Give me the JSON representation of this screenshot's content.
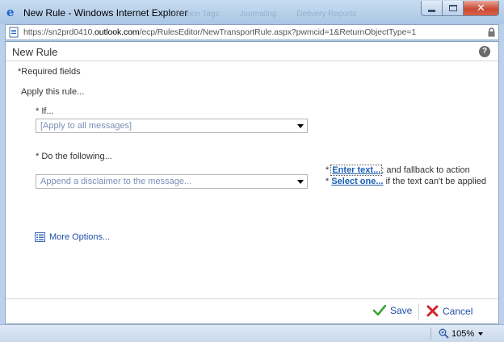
{
  "window": {
    "title": "New Rule - Windows Internet Explorer",
    "background_tabs": [
      "Retention Tags",
      "Journaling",
      "Delivery Reports"
    ]
  },
  "address": {
    "url_prefix": "https://sn2prd0410.",
    "url_domain": "outlook.com",
    "url_suffix": "/ecp/RulesEditor/NewTransportRule.aspx?pwmcid=1&ReturnObjectType=1"
  },
  "page": {
    "title": "New Rule",
    "required_note": "*Required fields",
    "apply_label": "Apply this rule...",
    "if_label": "* If...",
    "if_value": "[Apply to all messages]",
    "do_label": "* Do the following...",
    "do_value": "Append a disclaimer to the message...",
    "extra": {
      "star1": "* ",
      "enter_text_link": "Enter text...",
      "fallback_text": "; and fallback to action",
      "star2": "* ",
      "select_one_link": "Select one...",
      "cant_apply_text": " if the text can't be applied"
    },
    "more_options": "More Options..."
  },
  "footer": {
    "save": "Save",
    "cancel": "Cancel"
  },
  "status": {
    "zoom": "105%"
  },
  "colors": {
    "link": "#1f4fa8",
    "frame": "#b9d1ea",
    "close_button": "#c94a34"
  }
}
